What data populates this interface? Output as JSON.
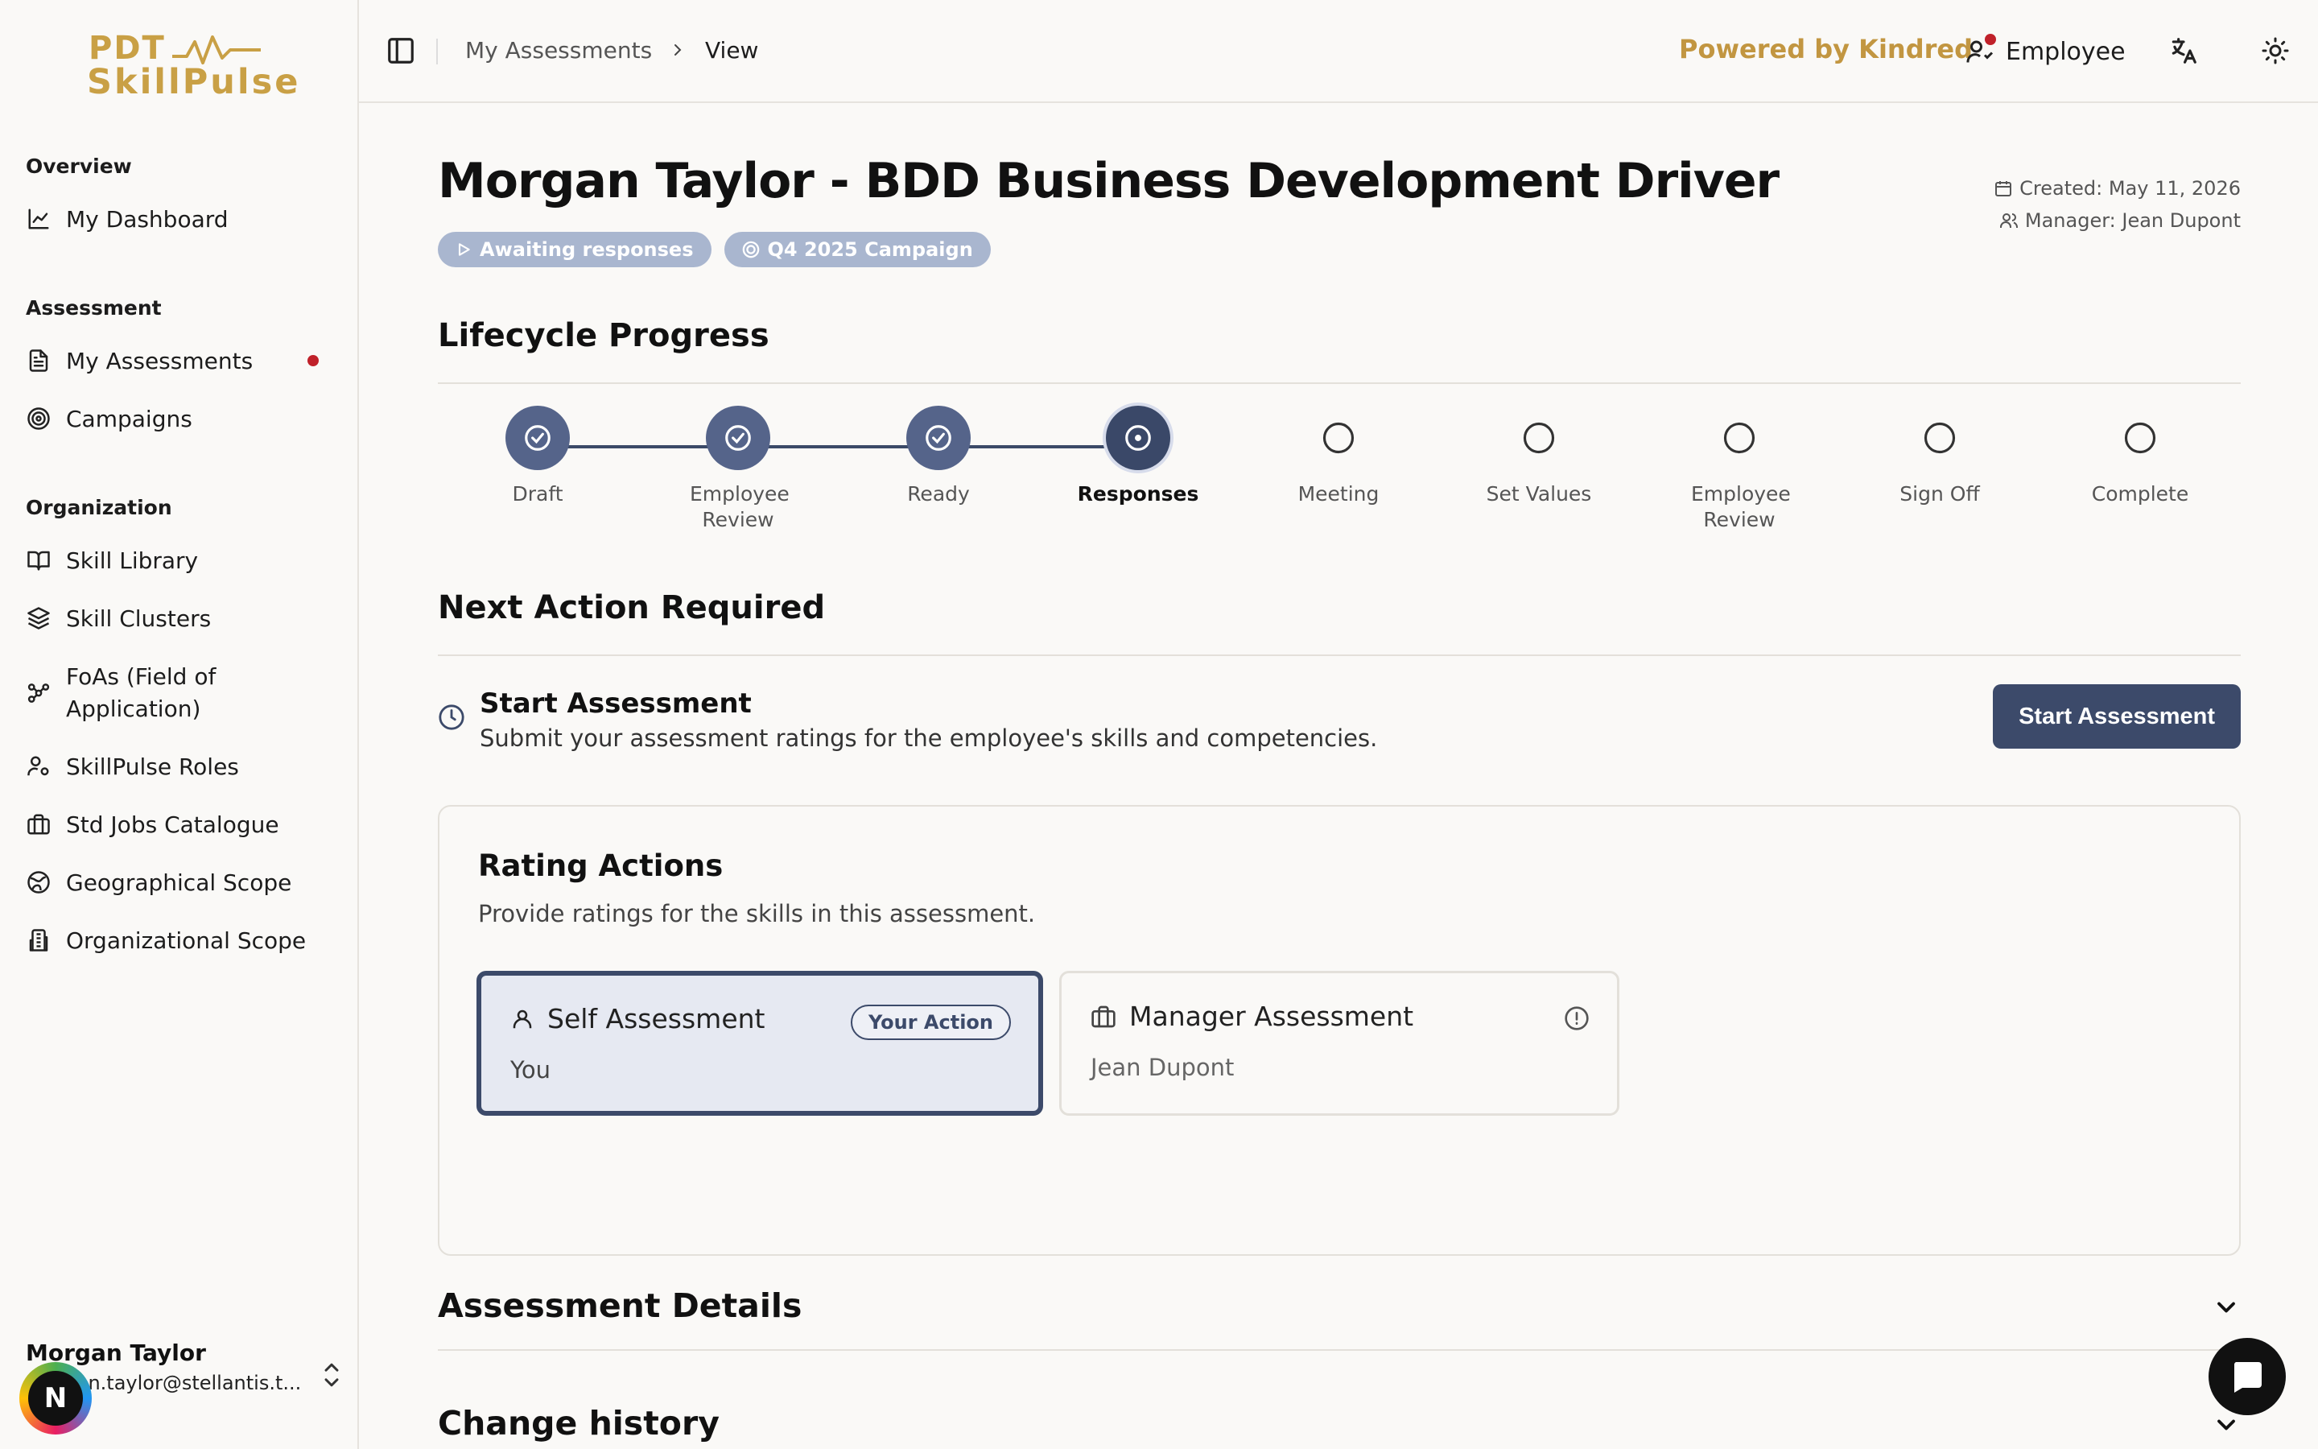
{
  "app": {
    "logo_top": "PDT",
    "logo_bottom": "SkillPulse"
  },
  "sidebar": {
    "sections": [
      {
        "title": "Overview",
        "items": [
          {
            "label": "My Dashboard",
            "icon": "chart-line-icon"
          }
        ]
      },
      {
        "title": "Assessment",
        "items": [
          {
            "label": "My Assessments",
            "icon": "file-text-icon",
            "notification": true
          },
          {
            "label": "Campaigns",
            "icon": "target-icon"
          }
        ]
      },
      {
        "title": "Organization",
        "items": [
          {
            "label": "Skill Library",
            "icon": "book-open-icon"
          },
          {
            "label": "Skill Clusters",
            "icon": "layers-icon"
          },
          {
            "label": "FoAs (Field of Application)",
            "icon": "workflow-icon"
          },
          {
            "label": "SkillPulse Roles",
            "icon": "user-cog-icon"
          },
          {
            "label": "Std Jobs Catalogue",
            "icon": "briefcase-icon"
          },
          {
            "label": "Geographical Scope",
            "icon": "globe-icon"
          },
          {
            "label": "Organizational Scope",
            "icon": "building-icon"
          }
        ]
      }
    ],
    "user": {
      "name": "Morgan Taylor",
      "email": "morgan.taylor@stellantis.t...",
      "avatar_letter": "N"
    }
  },
  "topbar": {
    "breadcrumb": [
      "My Assessments",
      "View"
    ],
    "powered_by": "Powered by Kindred",
    "role": "Employee",
    "brand_color": "#c29641"
  },
  "page": {
    "title": "Morgan Taylor - BDD Business Development Driver",
    "badges": [
      "Awaiting responses",
      "Q4 2025 Campaign"
    ],
    "created": "Created: May 11, 2026",
    "manager": "Manager: Jean Dupont"
  },
  "lifecycle": {
    "title": "Lifecycle Progress",
    "steps": [
      {
        "label": "Draft",
        "status": "done"
      },
      {
        "label": "Employee Review",
        "status": "done"
      },
      {
        "label": "Ready",
        "status": "done"
      },
      {
        "label": "Responses",
        "status": "current"
      },
      {
        "label": "Meeting",
        "status": "todo"
      },
      {
        "label": "Set Values",
        "status": "todo"
      },
      {
        "label": "Employee Review",
        "status": "todo"
      },
      {
        "label": "Sign Off",
        "status": "todo"
      },
      {
        "label": "Complete",
        "status": "todo"
      }
    ]
  },
  "next_action": {
    "title": "Next Action Required",
    "action_title": "Start Assessment",
    "action_desc": "Submit your assessment ratings for the employee's skills and competencies.",
    "button": "Start Assessment"
  },
  "rating_actions": {
    "title": "Rating Actions",
    "desc": "Provide ratings for the skills in this assessment.",
    "self": {
      "title": "Self Assessment",
      "who": "You",
      "pill": "Your Action"
    },
    "manager": {
      "title": "Manager Assessment",
      "who": "Jean Dupont"
    }
  },
  "sections": {
    "details": "Assessment Details",
    "history": "Change history"
  },
  "colors": {
    "accent": "#3c4a6a",
    "badge_bg": "#a9b6cf",
    "notification": "#c0212a"
  }
}
